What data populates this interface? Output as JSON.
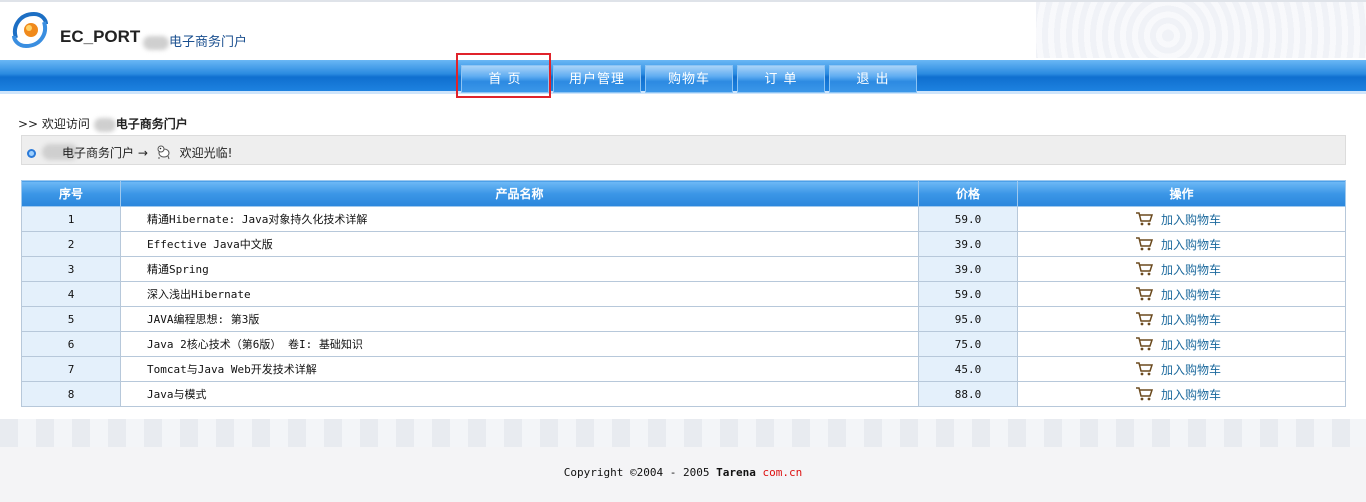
{
  "header": {
    "brand": "EC_PORT",
    "portal_name": "电子商务门户",
    "portal_prefix": "达"
  },
  "nav": {
    "items": [
      {
        "label": "首 页",
        "active": true
      },
      {
        "label": "用户管理"
      },
      {
        "label": "购物车"
      },
      {
        "label": "订 单"
      },
      {
        "label": "退 出"
      }
    ]
  },
  "welcome": {
    "prefix": ">> 欢迎访问",
    "site": "电子商务门户"
  },
  "breadcrumb": {
    "portal": "电子商务门户",
    "arrow": "→",
    "greeting": "欢迎光临!"
  },
  "table": {
    "headers": [
      "序号",
      "产品名称",
      "价格",
      "操作"
    ],
    "action_label": "加入购物车",
    "rows": [
      {
        "idx": "1",
        "name": "精通Hibernate: Java对象持久化技术详解",
        "price": "59.0"
      },
      {
        "idx": "2",
        "name": "Effective Java中文版",
        "price": "39.0"
      },
      {
        "idx": "3",
        "name": "精通Spring",
        "price": "39.0"
      },
      {
        "idx": "4",
        "name": "深入浅出Hibernate",
        "price": "59.0"
      },
      {
        "idx": "5",
        "name": "JAVA编程思想: 第3版",
        "price": "95.0"
      },
      {
        "idx": "6",
        "name": "Java 2核心技术（第6版） 卷I: 基础知识",
        "price": "75.0"
      },
      {
        "idx": "7",
        "name": "Tomcat与Java Web开发技术详解",
        "price": "45.0"
      },
      {
        "idx": "8",
        "name": "Java与模式",
        "price": "88.0"
      }
    ]
  },
  "footer": {
    "copyright": "Copyright ©2004 - 2005",
    "company": "Tarena",
    "domain": "com.cn"
  },
  "colors": {
    "nav_blue": "#2a8ae0",
    "highlight_red": "#e0232b",
    "link_teal": "#1e6b9e"
  }
}
